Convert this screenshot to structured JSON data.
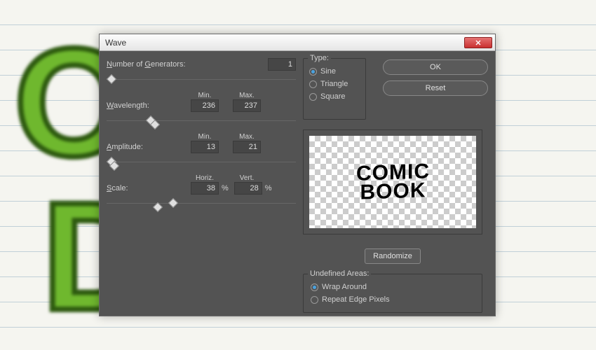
{
  "window": {
    "title": "Wave"
  },
  "generators": {
    "label": "Number of Generators:",
    "value": "1"
  },
  "wavelength": {
    "label": "Wavelength:",
    "min_label": "Min.",
    "max_label": "Max.",
    "min": "236",
    "max": "237"
  },
  "amplitude": {
    "label": "Amplitude:",
    "min_label": "Min.",
    "max_label": "Max.",
    "min": "13",
    "max": "21"
  },
  "scale": {
    "label": "Scale:",
    "horiz_label": "Horiz.",
    "vert_label": "Vert.",
    "horiz": "38",
    "vert": "28",
    "pct": "%"
  },
  "type": {
    "title": "Type:",
    "options": [
      {
        "label": "Sine",
        "underline": "i",
        "checked": true
      },
      {
        "label": "Triangle",
        "underline": "T",
        "checked": false
      },
      {
        "label": "Square",
        "underline": "q",
        "checked": false
      }
    ]
  },
  "buttons": {
    "ok": "OK",
    "reset": "Reset",
    "randomize": "Randomize"
  },
  "preview": {
    "line1": "COMIC",
    "line2": "BOOK"
  },
  "undef": {
    "title": "Undefined Areas:",
    "options": [
      {
        "label": "Wrap Around",
        "checked": true
      },
      {
        "label": "Repeat Edge Pixels",
        "checked": false
      }
    ]
  }
}
